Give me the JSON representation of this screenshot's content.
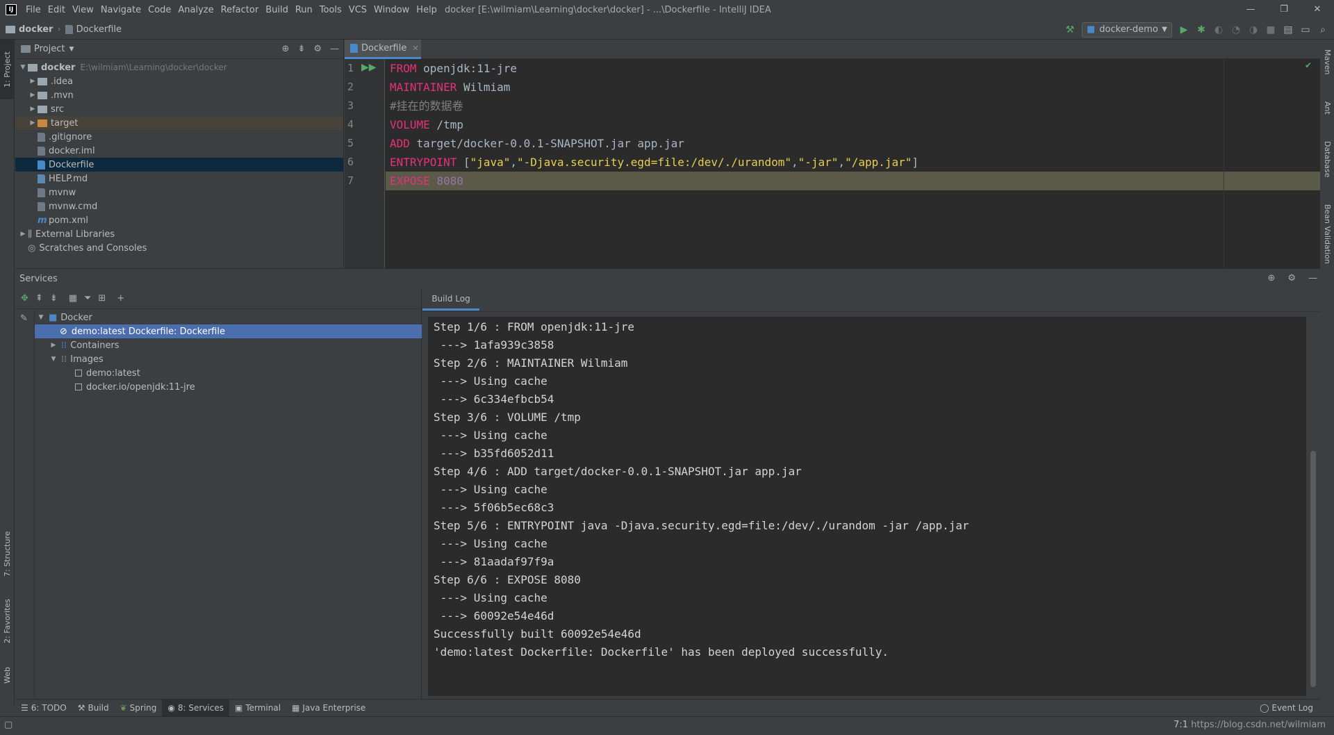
{
  "window": {
    "title": "docker [E:\\wilmiam\\Learning\\docker\\docker] - ...\\Dockerfile - IntelliJ IDEA",
    "controls": [
      "—",
      "❐",
      "✕"
    ]
  },
  "menu": [
    "File",
    "Edit",
    "View",
    "Navigate",
    "Code",
    "Analyze",
    "Refactor",
    "Build",
    "Run",
    "Tools",
    "VCS",
    "Window",
    "Help"
  ],
  "breadcrumb": {
    "project": "docker",
    "file": "Dockerfile"
  },
  "run_config": "docker-demo",
  "left_tabs": {
    "project": "1: Project",
    "structure": "7: Structure",
    "favorites": "2: Favorites",
    "web": "Web"
  },
  "right_tabs": {
    "maven": "Maven",
    "ant": "Ant",
    "database": "Database",
    "bean": "Bean Validation"
  },
  "project": {
    "header": "Project",
    "root_name": "docker",
    "root_path": "E:\\wilmiam\\Learning\\docker\\docker",
    "items": [
      {
        "label": ".idea"
      },
      {
        "label": ".mvn"
      },
      {
        "label": "src"
      },
      {
        "label": "target"
      },
      {
        "label": ".gitignore"
      },
      {
        "label": "docker.iml"
      },
      {
        "label": "Dockerfile"
      },
      {
        "label": "HELP.md"
      },
      {
        "label": "mvnw"
      },
      {
        "label": "mvnw.cmd"
      },
      {
        "label": "pom.xml"
      },
      {
        "label": "External Libraries"
      },
      {
        "label": "Scratches and Consoles"
      }
    ]
  },
  "editor": {
    "tab": "Dockerfile",
    "line_numbers": [
      "1",
      "2",
      "3",
      "4",
      "5",
      "6",
      "7"
    ],
    "lines": [
      {
        "kw": "FROM",
        "rest": " openjdk:11-jre"
      },
      {
        "kw": "MAINTAINER",
        "rest": " Wilmiam"
      },
      {
        "comment": "#挂在的数据卷"
      },
      {
        "kw": "VOLUME",
        "rest": " /tmp"
      },
      {
        "kw": "ADD",
        "rest": " target/docker-0.0.1-SNAPSHOT.jar app.jar"
      },
      {
        "kw": "ENTRYPOINT",
        "rest": " [\"java\",\"-Djava.security.egd=file:/dev/./urandom\",\"-jar\",\"/app.jar\"]"
      },
      {
        "kw": "EXPOSE",
        "num": "8080"
      }
    ]
  },
  "services": {
    "header": "Services",
    "tree": {
      "docker": "Docker",
      "deployment": "demo:latest Dockerfile: Dockerfile",
      "containers": "Containers",
      "images": "Images",
      "image1": "demo:latest",
      "image2": "docker.io/openjdk:11-jre"
    },
    "log_tab": "Build Log",
    "log_lines": [
      "Step 1/6 : FROM openjdk:11-jre",
      " ---> 1afa939c3858",
      "Step 2/6 : MAINTAINER Wilmiam",
      " ---> Using cache",
      " ---> 6c334efbcb54",
      "Step 3/6 : VOLUME /tmp",
      " ---> Using cache",
      " ---> b35fd6052d11",
      "Step 4/6 : ADD target/docker-0.0.1-SNAPSHOT.jar app.jar",
      " ---> Using cache",
      " ---> 5f06b5ec68c3",
      "Step 5/6 : ENTRYPOINT java -Djava.security.egd=file:/dev/./urandom -jar /app.jar",
      " ---> Using cache",
      " ---> 81aadaf97f9a",
      "Step 6/6 : EXPOSE 8080",
      " ---> Using cache",
      " ---> 60092e54e46d",
      "Successfully built 60092e54e46d",
      "'demo:latest Dockerfile: Dockerfile' has been deployed successfully."
    ]
  },
  "bottom_tabs": [
    "6: TODO",
    "Build",
    "Spring",
    "8: Services",
    "Terminal",
    "Java Enterprise"
  ],
  "event_log": "Event Log",
  "status": {
    "position": "7:1",
    "watermark": "https://blog.csdn.net/wilmiam"
  },
  "colors": {
    "keyword": "#e5317a",
    "string": "#e7d04d",
    "number": "#9876aa",
    "selection": "#4b6eaf",
    "accent": "#4a88c7"
  }
}
